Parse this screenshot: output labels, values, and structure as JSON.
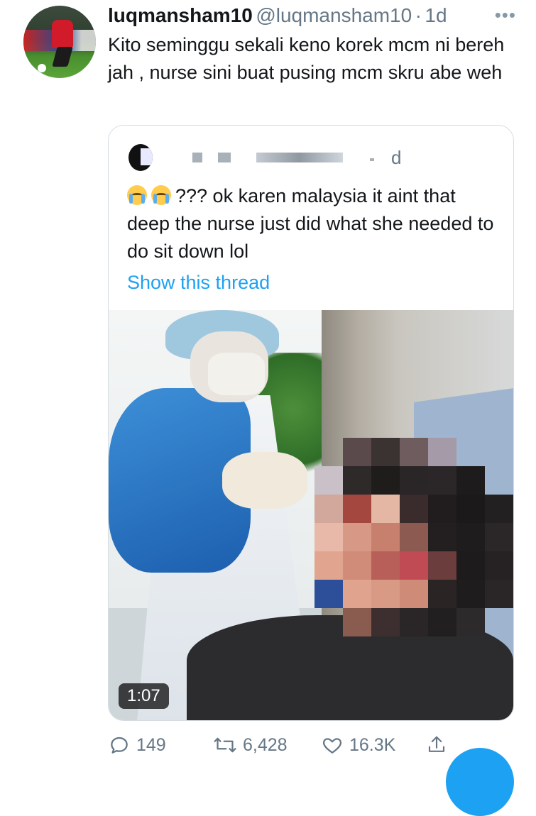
{
  "tweet": {
    "display_name": "luqmansham10",
    "handle": "@luqmansham10",
    "separator": "·",
    "age": "1d",
    "more_icon": "ellipsis-icon",
    "text": "Kito seminggu sekali keno korek mcm ni bereh jah , nurse sini buat pusing mcm skru abe weh"
  },
  "quoted": {
    "date": "d",
    "emoji_icon": "loudly-crying-face-icon",
    "text": "??? ok karen malaysia it aint that deep the nurse just did what she needed to do sit down lol",
    "show_thread": "Show this thread",
    "video_duration": "1:07"
  },
  "actions": {
    "reply_count": "149",
    "retweet_count": "6,428",
    "like_count": "16.3K"
  },
  "colors": {
    "accent": "#1da1f2",
    "secondary_text": "#657786",
    "primary_text": "#14171a"
  }
}
